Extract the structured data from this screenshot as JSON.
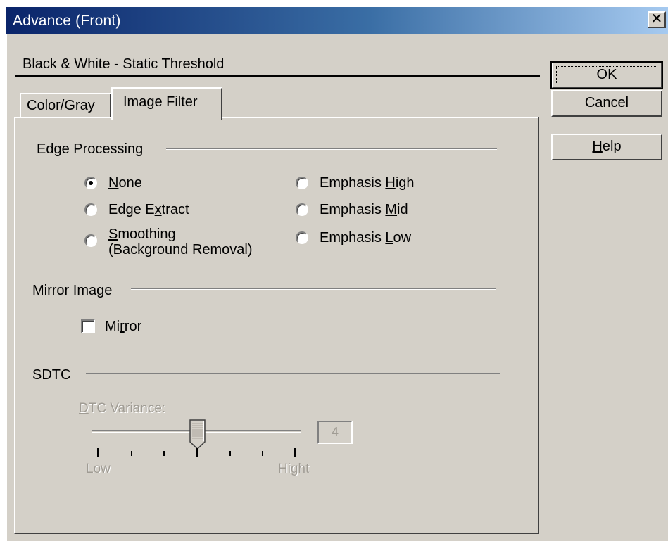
{
  "window": {
    "title": "Advance (Front)",
    "close_glyph": "✕"
  },
  "mode_label": "Black & White - Static Threshold",
  "buttons": {
    "ok": "OK",
    "cancel": "Cancel",
    "help_prefix": "",
    "help_mnemonic": "H",
    "help_rest": "elp"
  },
  "tabs": [
    {
      "label": "Color/Gray",
      "selected": false
    },
    {
      "label": "Image Filter",
      "selected": true
    }
  ],
  "edge_processing": {
    "title": "Edge Processing",
    "selected": "None",
    "options": [
      {
        "pre": "",
        "mn": "N",
        "post": "one"
      },
      {
        "pre": "Edge E",
        "mn": "x",
        "post": "tract"
      },
      {
        "pre": "",
        "mn": "S",
        "post": "moothing",
        "line2": "(Background Removal)"
      },
      {
        "pre": "Emphasis ",
        "mn": "H",
        "post": "igh"
      },
      {
        "pre": "Emphasis ",
        "mn": "M",
        "post": "id"
      },
      {
        "pre": "Emphasis ",
        "mn": "L",
        "post": "ow"
      }
    ]
  },
  "mirror_image": {
    "title": "Mirror Image",
    "checkbox": {
      "pre": "Mi",
      "mn": "r",
      "post": "ror",
      "checked": false
    }
  },
  "sdtc": {
    "title": "SDTC",
    "variance_pre": "",
    "variance_mn": "D",
    "variance_post": "TC Variance:",
    "low_label": "Low",
    "high_label": "Hight",
    "value": "4",
    "enabled": false
  },
  "icons": {
    "close": "close-icon",
    "radio_selected": "radio-selected-icon"
  }
}
